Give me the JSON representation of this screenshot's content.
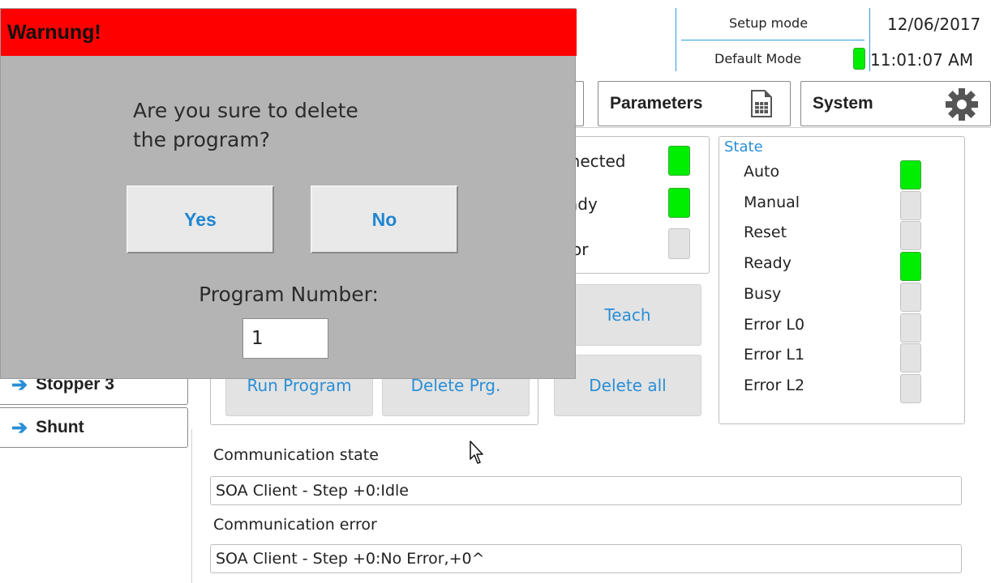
{
  "header": {
    "mode_label": "Setup mode",
    "submode_label": "Default Mode",
    "date": "12/06/2017",
    "time": "11:01:07 AM"
  },
  "tabs": {
    "parameters": "Parameters",
    "system": "System"
  },
  "connection_panel": {
    "connected_label": "nnected",
    "ready_label": "ady",
    "error_label": "or"
  },
  "state_panel": {
    "title": "State",
    "items": [
      {
        "label": "Auto",
        "on": true
      },
      {
        "label": "Manual",
        "on": false
      },
      {
        "label": "Reset",
        "on": false
      },
      {
        "label": "Ready",
        "on": true
      },
      {
        "label": "Busy",
        "on": false
      },
      {
        "label": "Error L0",
        "on": false
      },
      {
        "label": "Error L1",
        "on": false
      },
      {
        "label": "Error L2",
        "on": false
      }
    ]
  },
  "program_buttons": {
    "teach": "Teach",
    "run": "Run Program",
    "delete": "Delete Prg.",
    "delete_all": "Delete all"
  },
  "sidebar": {
    "items": [
      {
        "label": "Stopper 3"
      },
      {
        "label": "Shunt"
      }
    ]
  },
  "communication": {
    "state_label": "Communication state",
    "state_value": "SOA Client - Step +0:Idle",
    "error_label": "Communication error",
    "error_value": "SOA Client - Step +0:No Error,+0^"
  },
  "dialog": {
    "title": "Warnung!",
    "message_line1": "Are you sure to delete",
    "message_line2": "the program?",
    "yes": "Yes",
    "no": "No",
    "program_label": "Program Number:",
    "program_value": "1"
  },
  "colors": {
    "led_on": "#00ee00",
    "led_off": "#e3e3e3",
    "accent": "#2a8fd6",
    "warning": "#ff0000"
  }
}
